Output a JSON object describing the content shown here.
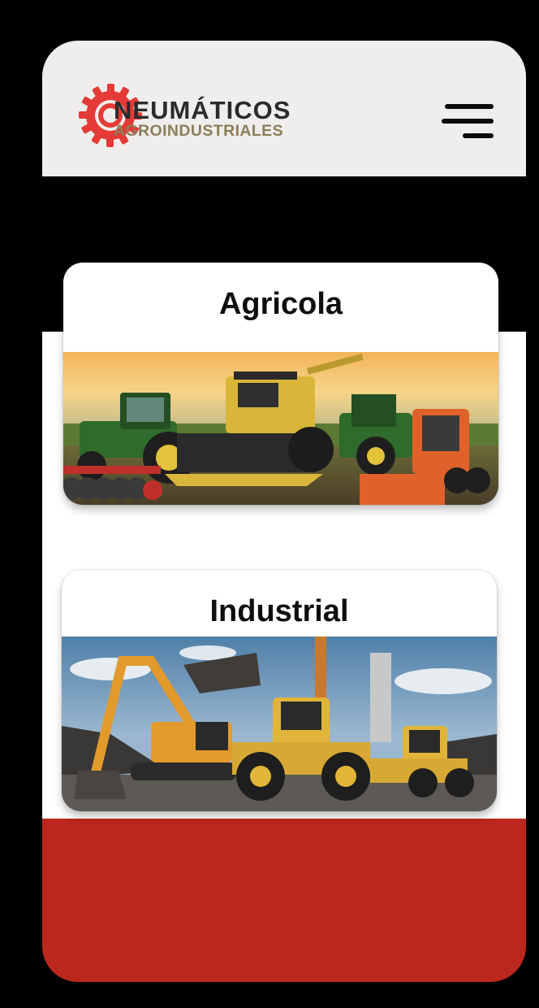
{
  "header": {
    "brand": {
      "line1": "NEUMÁTICOS",
      "line2": "AGROINDUSTRIALES",
      "logo_icon": "tire-icon"
    },
    "menu_icon": "hamburger-menu-icon"
  },
  "categories": [
    {
      "title": "Agricola",
      "image": "agricultural-machinery-photo"
    },
    {
      "title": "Industrial",
      "image": "construction-machinery-photo"
    }
  ],
  "colors": {
    "brand_red": "#e53a35",
    "footer_red": "#bc271d",
    "header_bg": "#efeeec",
    "brand_dark": "#2b2b2b",
    "brand_gold": "#8c7d5a"
  }
}
